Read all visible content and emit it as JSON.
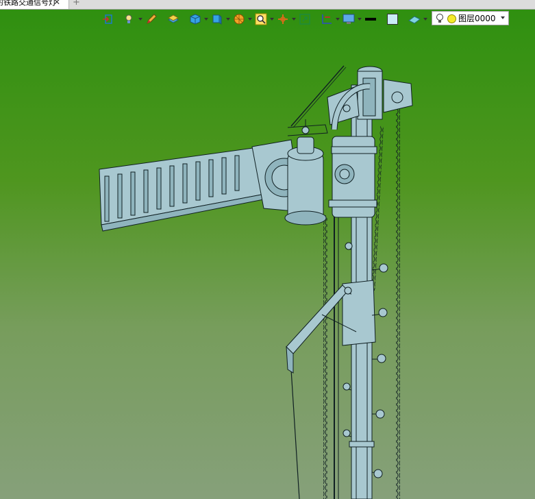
{
  "tabbar": {
    "active_tab_label": "的铁路交通信号灯",
    "close_glyph": "✕",
    "add_glyph": "+"
  },
  "toolbar": {
    "buttons": [
      {
        "icon": "exit-sketch-icon",
        "has_dropdown": false
      },
      {
        "icon": "light-bulb-icon",
        "has_dropdown": true
      },
      {
        "icon": "pencil-icon",
        "has_dropdown": false
      },
      {
        "icon": "stack-layers-icon",
        "has_dropdown": false
      },
      {
        "icon": "cube-icon",
        "has_dropdown": true
      },
      {
        "icon": "split-cube-icon",
        "has_dropdown": true
      },
      {
        "icon": "render-sphere-icon",
        "has_dropdown": true
      },
      {
        "icon": "zoom-icon",
        "has_dropdown": true
      },
      {
        "icon": "axis-origin-icon",
        "has_dropdown": true
      },
      {
        "icon": "fit-view-icon",
        "has_dropdown": false
      },
      {
        "icon": "section-plane-icon",
        "has_dropdown": true
      },
      {
        "icon": "monitor-display-icon",
        "has_dropdown": true
      },
      {
        "icon": "line-style-icon",
        "has_dropdown": false
      },
      {
        "icon": "color-swatch-icon",
        "has_dropdown": false
      },
      {
        "icon": "surface-layer-icon",
        "has_dropdown": true
      }
    ],
    "layer_selector": {
      "value": "图层0000",
      "bulb_icon": "light-bulb-icon",
      "color_dot": "#f4ea2a"
    }
  },
  "colors": {
    "viewport_top": "#2f9010",
    "viewport_bottom": "#86a07a",
    "model_fill": "#a8c8d0",
    "model_edge": "#0f1f22"
  },
  "model": {
    "name": "railway-semaphore-signal-3d-model"
  }
}
